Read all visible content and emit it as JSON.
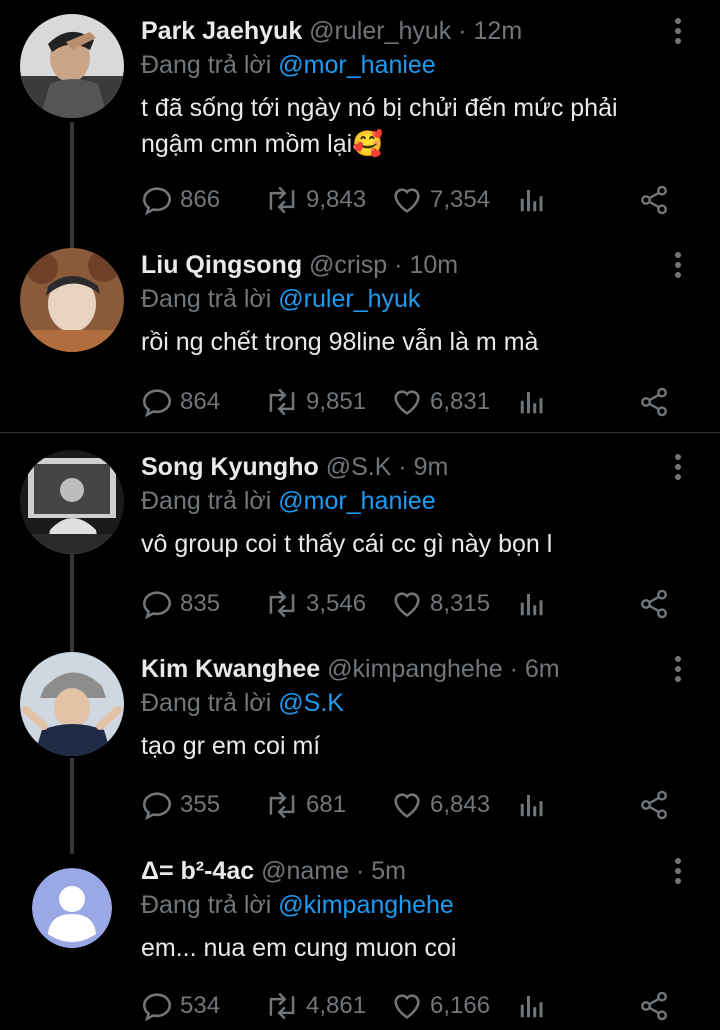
{
  "colors": {
    "background": "#000000",
    "text": "#e7e9ea",
    "muted": "#71767b",
    "link": "#1d9bf0"
  },
  "reply_prefix": "Đang trả lời",
  "tweets": [
    {
      "name": "Park Jaehyuk",
      "handle": "@ruler_hyuk",
      "time": "· 12m",
      "reply_to": "@mor_haniee",
      "text": "t đã sống tới ngày nó bị chửi đến mức phải ngậm cmn mồm lại🥰",
      "replies": "866",
      "retweets": "9,843",
      "likes": "7,354",
      "avatar_icon": "profile-photo"
    },
    {
      "name": "Liu Qingsong",
      "handle": "@crisp",
      "time": "· 10m",
      "reply_to": "@ruler_hyuk",
      "text": "rồi ng chết trong 98line vẫn là m mà",
      "replies": "864",
      "retweets": "9,851",
      "likes": "6,831",
      "avatar_icon": "profile-photo"
    },
    {
      "name": "Song Kyungho",
      "handle": "@S.K",
      "time": "· 9m",
      "reply_to": "@mor_haniee",
      "text": "vô group coi t thấy cái cc gì này bọn l",
      "replies": "835",
      "retweets": "3,546",
      "likes": "8,315",
      "avatar_icon": "profile-photo"
    },
    {
      "name": "Kim Kwanghee",
      "handle": "@kimpanghehe",
      "time": "· 6m",
      "reply_to": "@S.K",
      "text": "tạo gr em coi mí",
      "replies": "355",
      "retweets": "681",
      "likes": "6,843",
      "avatar_icon": "profile-photo"
    },
    {
      "name": "Δ= b²-4ac",
      "handle": "@name",
      "time": "· 5m",
      "reply_to": "@kimpanghehe",
      "text": "em... nua em cung muon coi",
      "replies": "534",
      "retweets": "4,861",
      "likes": "6,166",
      "avatar_icon": "default-avatar"
    }
  ]
}
